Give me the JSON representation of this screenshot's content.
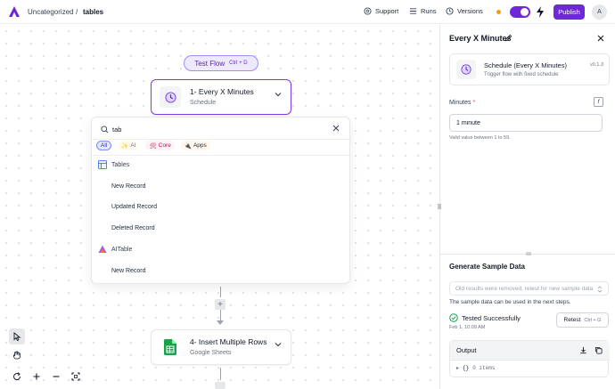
{
  "header": {
    "folder": "Uncategorized",
    "separator": "/",
    "flow_name": "tables",
    "support_label": "Support",
    "runs_label": "Runs",
    "versions_label": "Versions",
    "publish_label": "Publish",
    "avatar_initial": "A"
  },
  "canvas": {
    "test_flow_label": "Test Flow",
    "test_flow_shortcut": "Ctrl + D",
    "steps": [
      {
        "title": "1- Every X Minutes",
        "subtitle": "Schedule"
      },
      {
        "title": "4- Insert Multiple Rows",
        "subtitle": "Google Sheets"
      }
    ]
  },
  "picker": {
    "search_value": "tab",
    "filters": [
      {
        "label": "All"
      },
      {
        "label": "AI"
      },
      {
        "label": "Core"
      },
      {
        "label": "Apps"
      }
    ],
    "results": [
      {
        "kind": "group",
        "label": "Tables"
      },
      {
        "kind": "action",
        "label": "New Record"
      },
      {
        "kind": "action",
        "label": "Updated Record"
      },
      {
        "kind": "action",
        "label": "Deleted Record"
      },
      {
        "kind": "group",
        "label": "AITable"
      },
      {
        "kind": "action",
        "label": "New Record"
      }
    ]
  },
  "panel": {
    "title": "Every X Minutes",
    "trigger_title": "Schedule (Every X Minutes)",
    "trigger_desc": "Trigger flow with fixed schedule",
    "trigger_version": "v0.1.3",
    "field_label": "Minutes",
    "required_mark": "*",
    "fx_label": "f",
    "minutes_value": "1 minute",
    "hint": "Valid value between 1 to 59.",
    "sample_title": "Generate Sample Data",
    "old_results": "Old results were removed, retest for new sample data",
    "sample_note": "The sample data can be used in the next steps.",
    "tested_label": "Tested Successfully",
    "tested_time": "Feb 1, 10:09 AM",
    "retest_label": "Retest",
    "retest_shortcut": "Ctrl + G",
    "output_label": "Output",
    "output_brace": "{}",
    "output_items": "0 items"
  },
  "colors": {
    "accent": "#6d28d9",
    "success": "#16a34a",
    "warning_dot": "#f59e0b"
  }
}
